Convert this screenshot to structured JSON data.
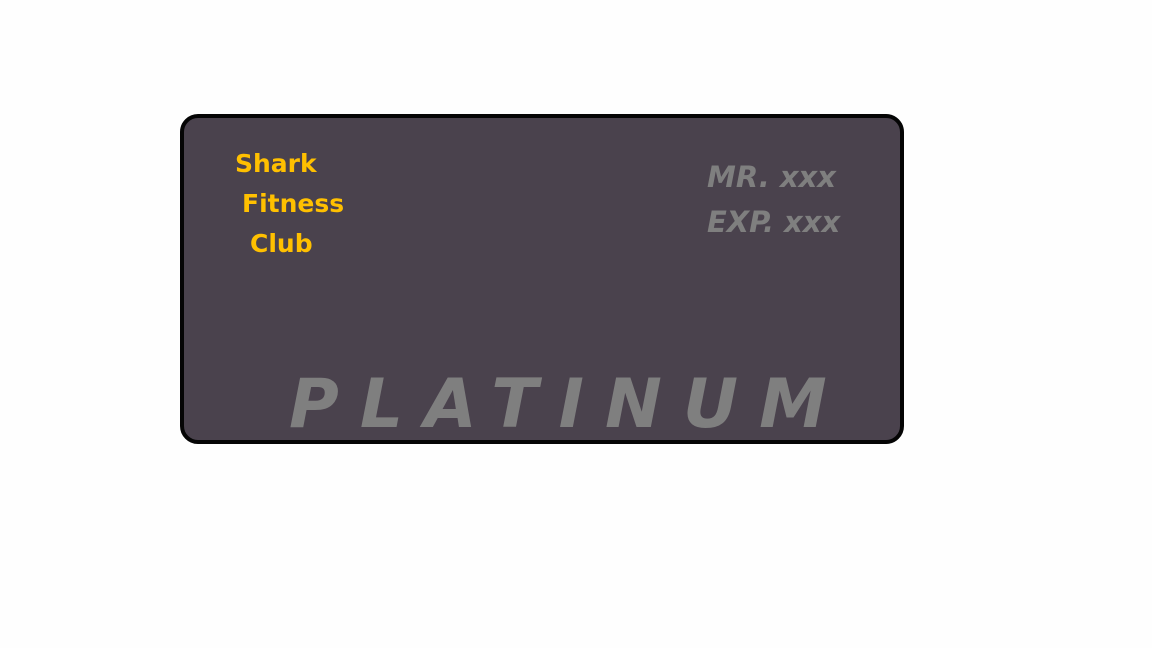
{
  "colors": {
    "page_background": "#fefefe",
    "card_background": "#4a424d",
    "card_border": "#050505",
    "club_text": "#ffc000",
    "muted_text": "#7f7f7f"
  },
  "card": {
    "club_name_lines": [
      "Shark",
      "Fitness",
      "Club"
    ],
    "holder_name": "MR. xxx",
    "expiry": "EXP. xxx",
    "tier": "PLATINUM"
  }
}
